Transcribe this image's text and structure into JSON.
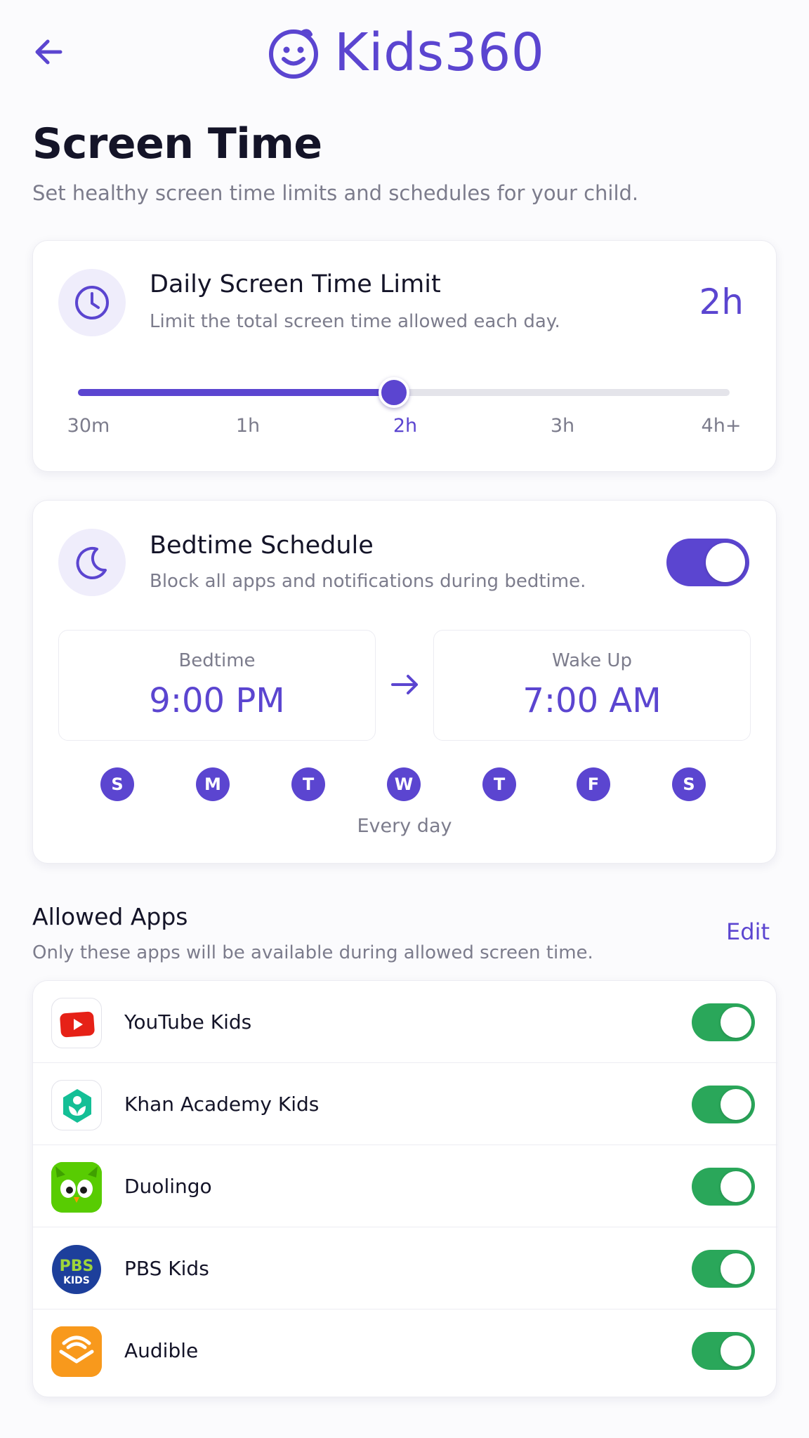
{
  "header": {
    "app_name": "Kids360"
  },
  "page": {
    "title": "Screen Time",
    "subtitle": "Set healthy screen time limits and schedules for your child."
  },
  "daily_limit": {
    "title": "Daily Screen Time Limit",
    "description": "Limit the total screen time allowed each day.",
    "value": "2h",
    "slider_labels": [
      "30m",
      "1h",
      "2h",
      "3h",
      "4h+"
    ],
    "selected_index": 2
  },
  "bedtime": {
    "title": "Bedtime Schedule",
    "description": "Block all apps and notifications during bedtime.",
    "enabled": true,
    "bedtime_label": "Bedtime",
    "bedtime_value": "9:00 PM",
    "wake_label": "Wake Up",
    "wake_value": "7:00 AM",
    "days": [
      "S",
      "M",
      "T",
      "W",
      "T",
      "F",
      "S"
    ],
    "days_caption": "Every day"
  },
  "allowed_apps": {
    "title": "Allowed Apps",
    "description": "Only these apps will be available during allowed screen time.",
    "edit_label": "Edit",
    "apps": [
      {
        "name": "YouTube Kids",
        "icon": "youtube-kids-icon",
        "enabled": true
      },
      {
        "name": "Khan Academy Kids",
        "icon": "khan-academy-kids-icon",
        "enabled": true
      },
      {
        "name": "Duolingo",
        "icon": "duolingo-icon",
        "enabled": true
      },
      {
        "name": "PBS Kids",
        "icon": "pbs-kids-icon",
        "enabled": true
      },
      {
        "name": "Audible",
        "icon": "audible-icon",
        "enabled": true
      }
    ],
    "pbs_icon_text": [
      "PBS",
      "KIDS"
    ]
  },
  "colors": {
    "accent": "#5b45d0",
    "toggle_on": "#2aa75a",
    "muted_text": "#7c7c8c"
  }
}
